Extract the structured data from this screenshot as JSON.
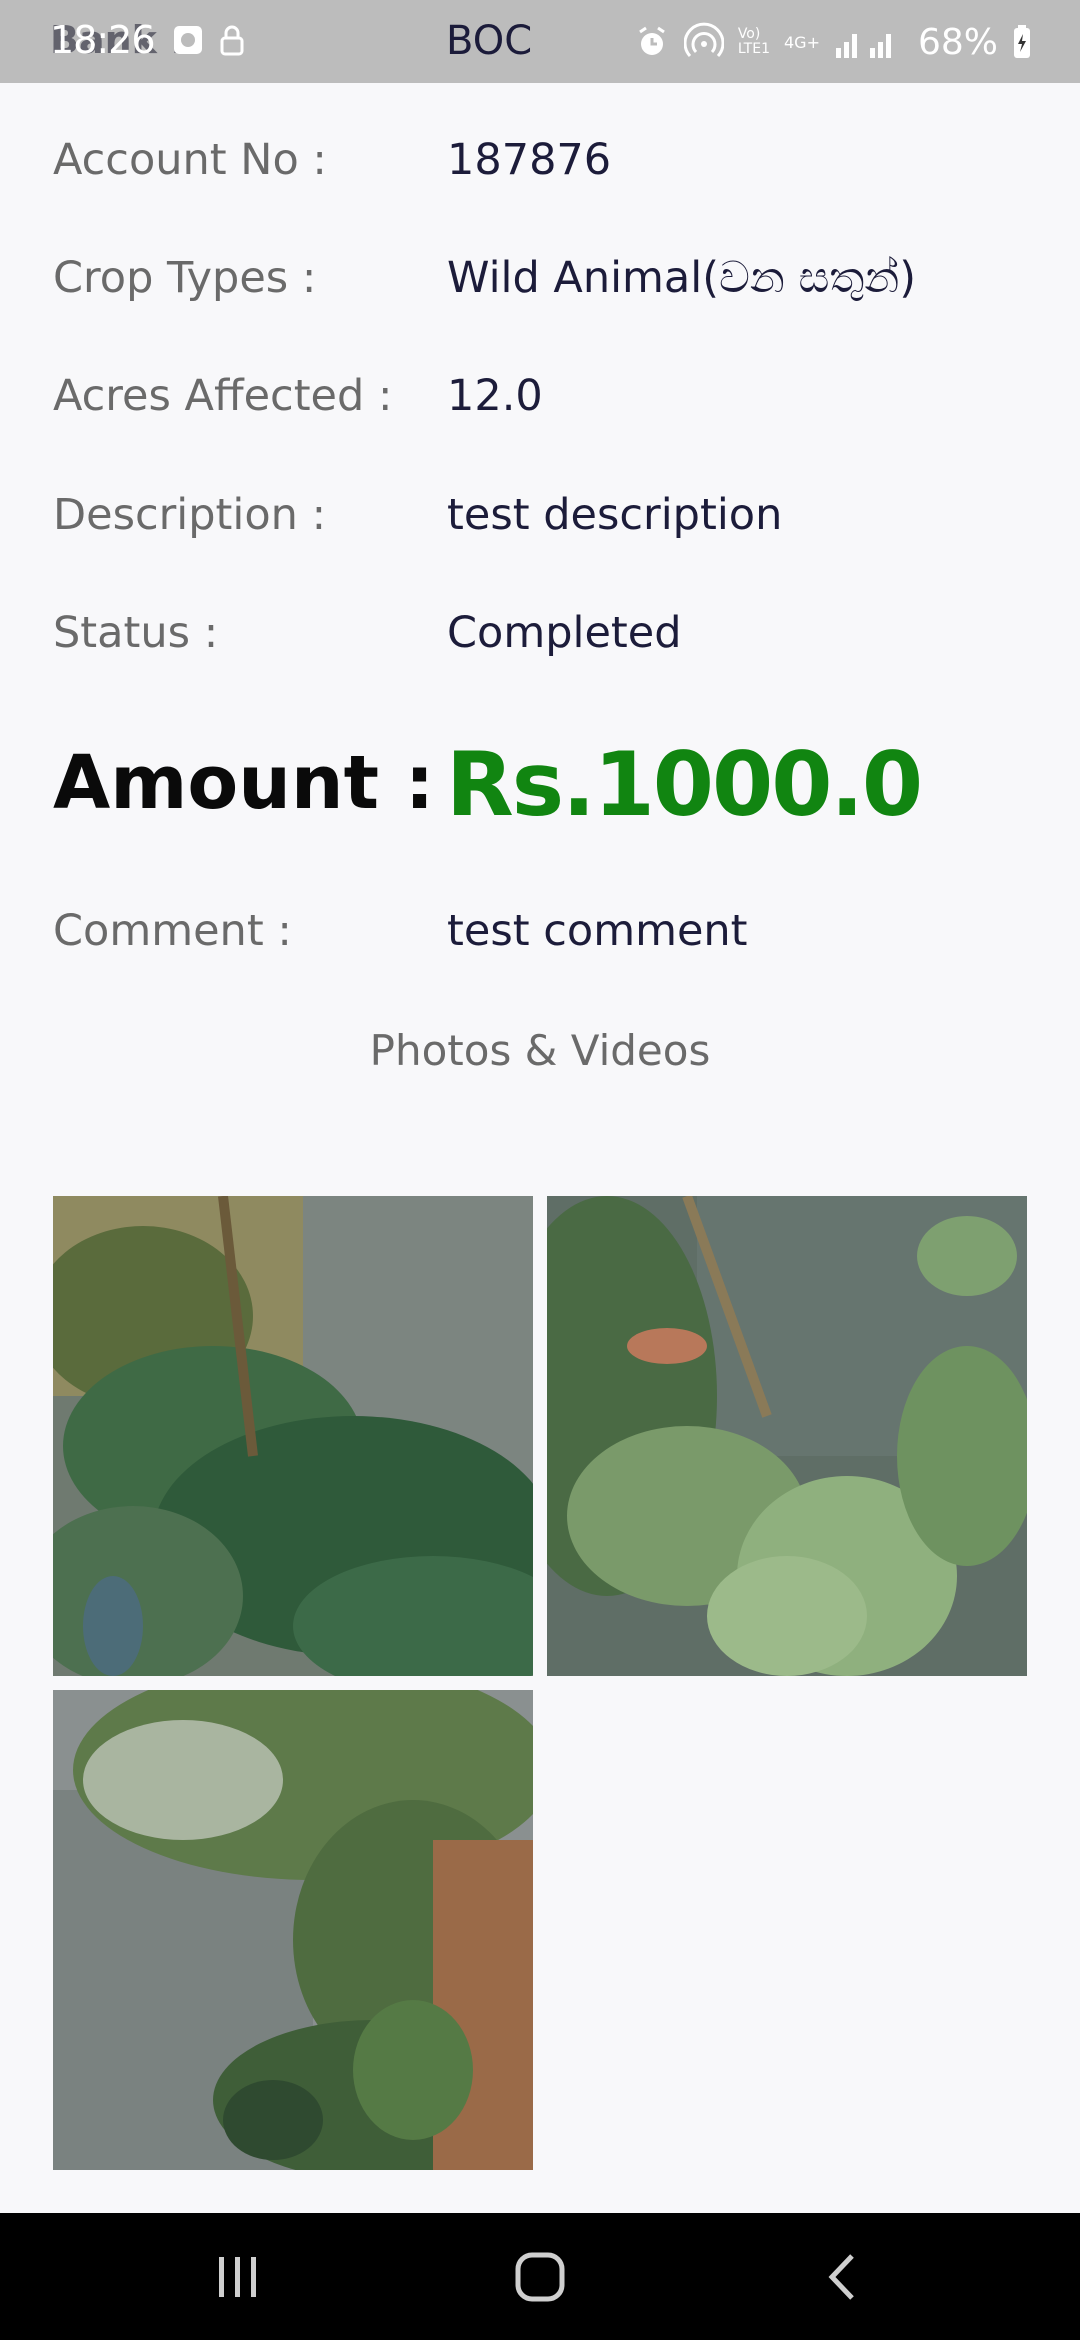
{
  "status_bar": {
    "time": "18:26",
    "overlap_text": "Bank :",
    "bank": "BOC",
    "battery": "68%",
    "network_label_1": "Vo)",
    "network_label_2": "LTE1",
    "network_label_3": "4G+"
  },
  "details": {
    "account_label": "Account No :",
    "account_value": "187876",
    "crop_label": "Crop Types :",
    "crop_value": "Wild Animal(වන සතුන්)",
    "acres_label": "Acres Affected :",
    "acres_value": "12.0",
    "description_label": "Description :",
    "description_value": "test description",
    "status_label": "Status :",
    "status_value": "Completed",
    "amount_label": "Amount :",
    "amount_value": "Rs.1000.0",
    "comment_label": "Comment :",
    "comment_value": "test comment"
  },
  "media": {
    "title": "Photos & Videos",
    "photos": [
      "photo-1",
      "photo-2",
      "photo-3"
    ]
  },
  "colors": {
    "amount": "#118511",
    "label": "#6a6a6a",
    "value": "#1c1c3a",
    "status_bar": "#bcbcbc",
    "nav_bar": "#000000"
  },
  "icons": {
    "status": [
      "media-icon",
      "lock-icon",
      "alarm-icon",
      "hotspot-icon",
      "signal-icon",
      "battery-icon"
    ],
    "nav": [
      "recents-icon",
      "home-icon",
      "back-icon"
    ]
  }
}
